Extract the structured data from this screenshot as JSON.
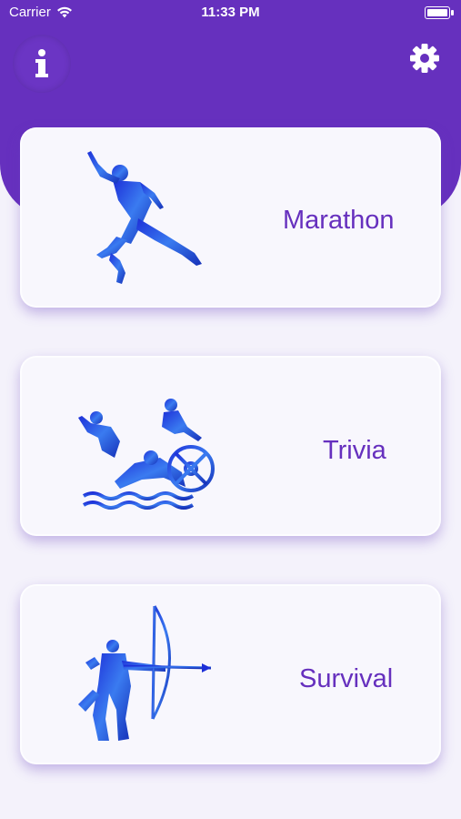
{
  "status_bar": {
    "carrier": "Carrier",
    "time": "11:33 PM"
  },
  "header": {
    "info_icon": "info-icon",
    "settings_icon": "gear-icon",
    "accent": "#6630be"
  },
  "cards": [
    {
      "label": "Marathon",
      "icon": "runner-illustration"
    },
    {
      "label": "Trivia",
      "icon": "triathlon-illustration"
    },
    {
      "label": "Survival",
      "icon": "archer-illustration"
    }
  ]
}
